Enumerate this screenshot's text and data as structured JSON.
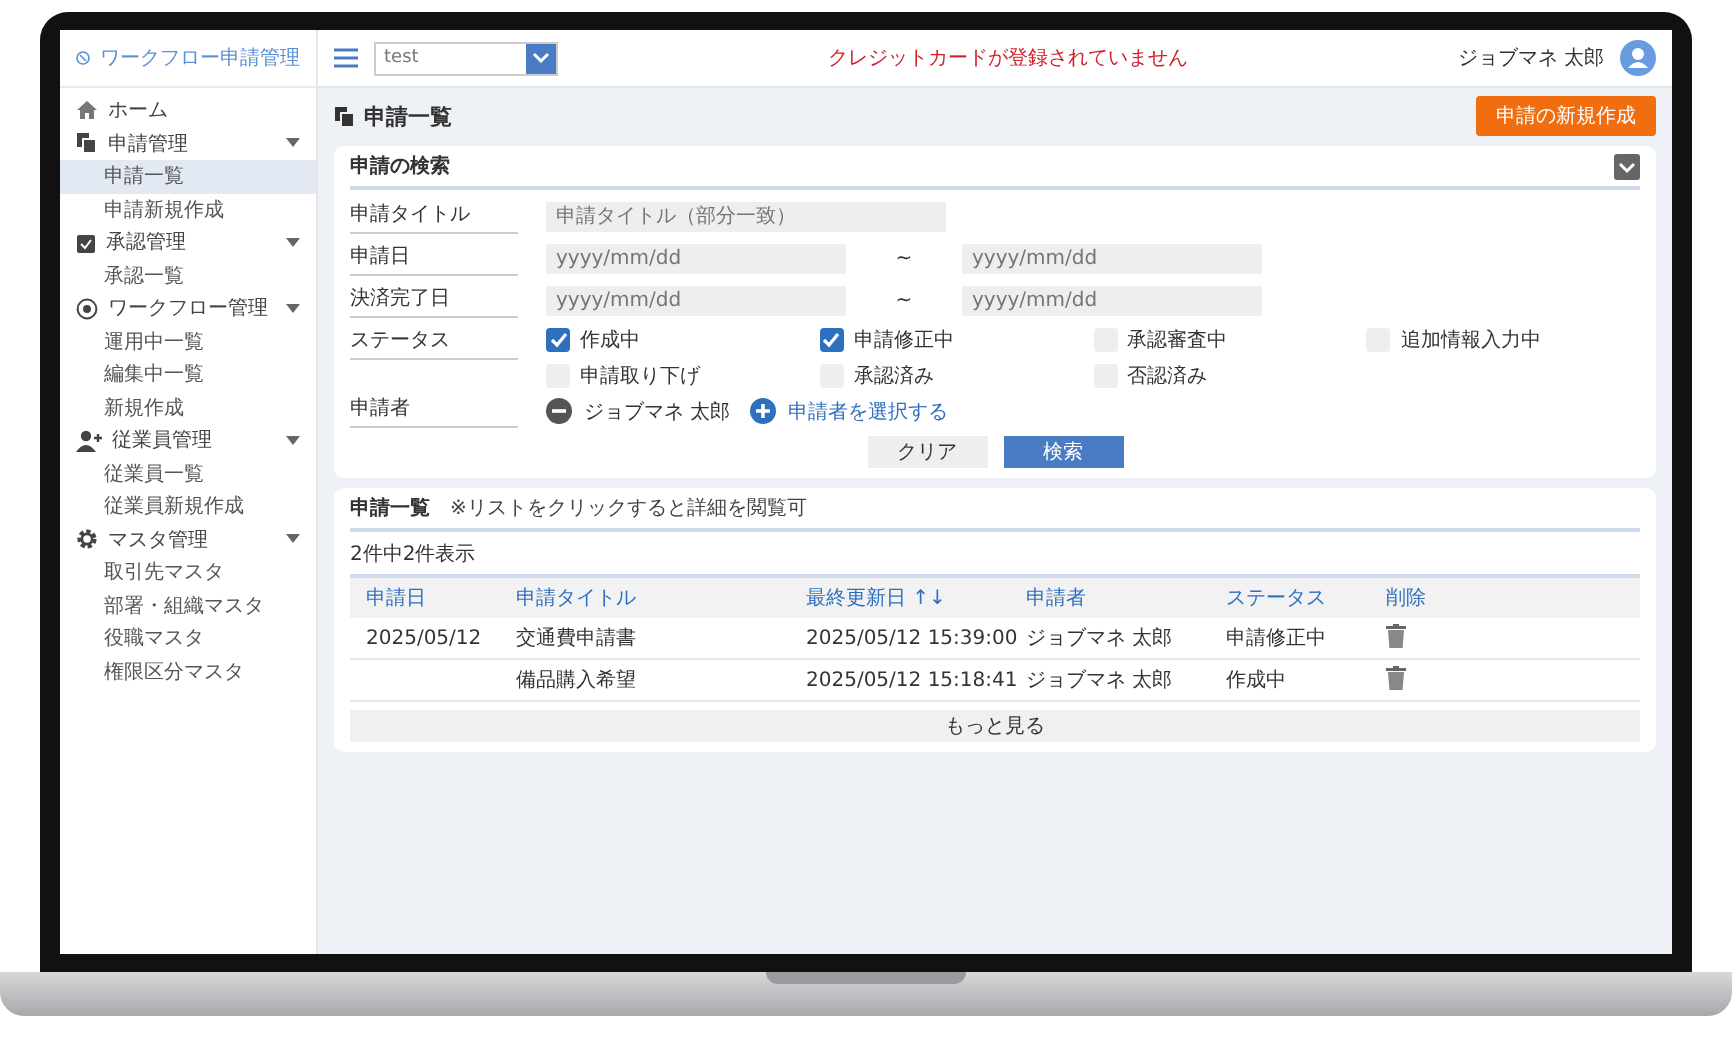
{
  "app": {
    "title": "ワークフロー申請管理"
  },
  "sidebar": {
    "home": {
      "label": "ホーム",
      "selected": false
    },
    "groups": [
      {
        "label": "申請管理",
        "children": [
          {
            "label": "申請一覧",
            "selected": true
          },
          {
            "label": "申請新規作成",
            "selected": false
          }
        ]
      },
      {
        "label": "承認管理",
        "children": [
          {
            "label": "承認一覧",
            "selected": false
          }
        ]
      },
      {
        "label": "ワークフロー管理",
        "children": [
          {
            "label": "運用中一覧",
            "selected": false
          },
          {
            "label": "編集中一覧",
            "selected": false
          },
          {
            "label": "新規作成",
            "selected": false
          }
        ]
      },
      {
        "label": "従業員管理",
        "children": [
          {
            "label": "従業員一覧",
            "selected": false
          },
          {
            "label": "従業員新規作成",
            "selected": false
          }
        ]
      },
      {
        "label": "マスタ管理",
        "children": [
          {
            "label": "取引先マスタ",
            "selected": false
          },
          {
            "label": "部署・組織マスタ",
            "selected": false
          },
          {
            "label": "役職マスタ",
            "selected": false
          },
          {
            "label": "権限区分マスタ",
            "selected": false
          }
        ]
      }
    ]
  },
  "header": {
    "select": {
      "value": "test"
    },
    "notice": "クレジットカードが登録されていません",
    "user": "ジョブマネ 太郎"
  },
  "page": {
    "title": "申請一覧",
    "new_button": "申請の新規作成"
  },
  "search": {
    "title": "申請の検索",
    "fields": [
      {
        "kind": "text",
        "label": "申請タイトル",
        "placeholder": "申請タイトル（部分一致）"
      },
      {
        "kind": "range",
        "label": "申請日",
        "from_placeholder": "yyyy/mm/dd",
        "separator": "~",
        "to_placeholder": "yyyy/mm/dd"
      },
      {
        "kind": "range",
        "label": "決済完了日",
        "from_placeholder": "yyyy/mm/dd",
        "separator": "~",
        "to_placeholder": "yyyy/mm/dd"
      }
    ],
    "status": {
      "label": "ステータス",
      "options": [
        {
          "label": "作成中",
          "checked": true
        },
        {
          "label": "申請修正中",
          "checked": true
        },
        {
          "label": "承認審査中",
          "checked": false
        },
        {
          "label": "追加情報入力中",
          "checked": false
        },
        {
          "label": "申請取り下げ",
          "checked": false
        },
        {
          "label": "承認済み",
          "checked": false
        },
        {
          "label": "否認済み",
          "checked": false
        }
      ]
    },
    "applicant": {
      "label": "申請者",
      "name": "ジョブマネ 太郎",
      "add_link": "申請者を選択する"
    },
    "clear_button": "クリア",
    "search_button": "検索"
  },
  "list": {
    "title": "申請一覧",
    "hint": "※リストをクリックすると詳細を閲覧可",
    "count": "2件中2件表示",
    "columns": [
      "申請日",
      "申請タイトル",
      "最終更新日 ↑↓",
      "申請者",
      "ステータス",
      "削除"
    ],
    "rows": [
      {
        "cells": [
          "2025/05/12",
          "交通費申請書",
          "2025/05/12 15:39:00",
          "ジョブマネ 太郎",
          "申請修正中"
        ]
      },
      {
        "cells": [
          "",
          "備品購入希望",
          "2025/05/12 15:18:41",
          "ジョブマネ 太郎",
          "作成中"
        ]
      }
    ],
    "more_button": "もっと見る"
  }
}
